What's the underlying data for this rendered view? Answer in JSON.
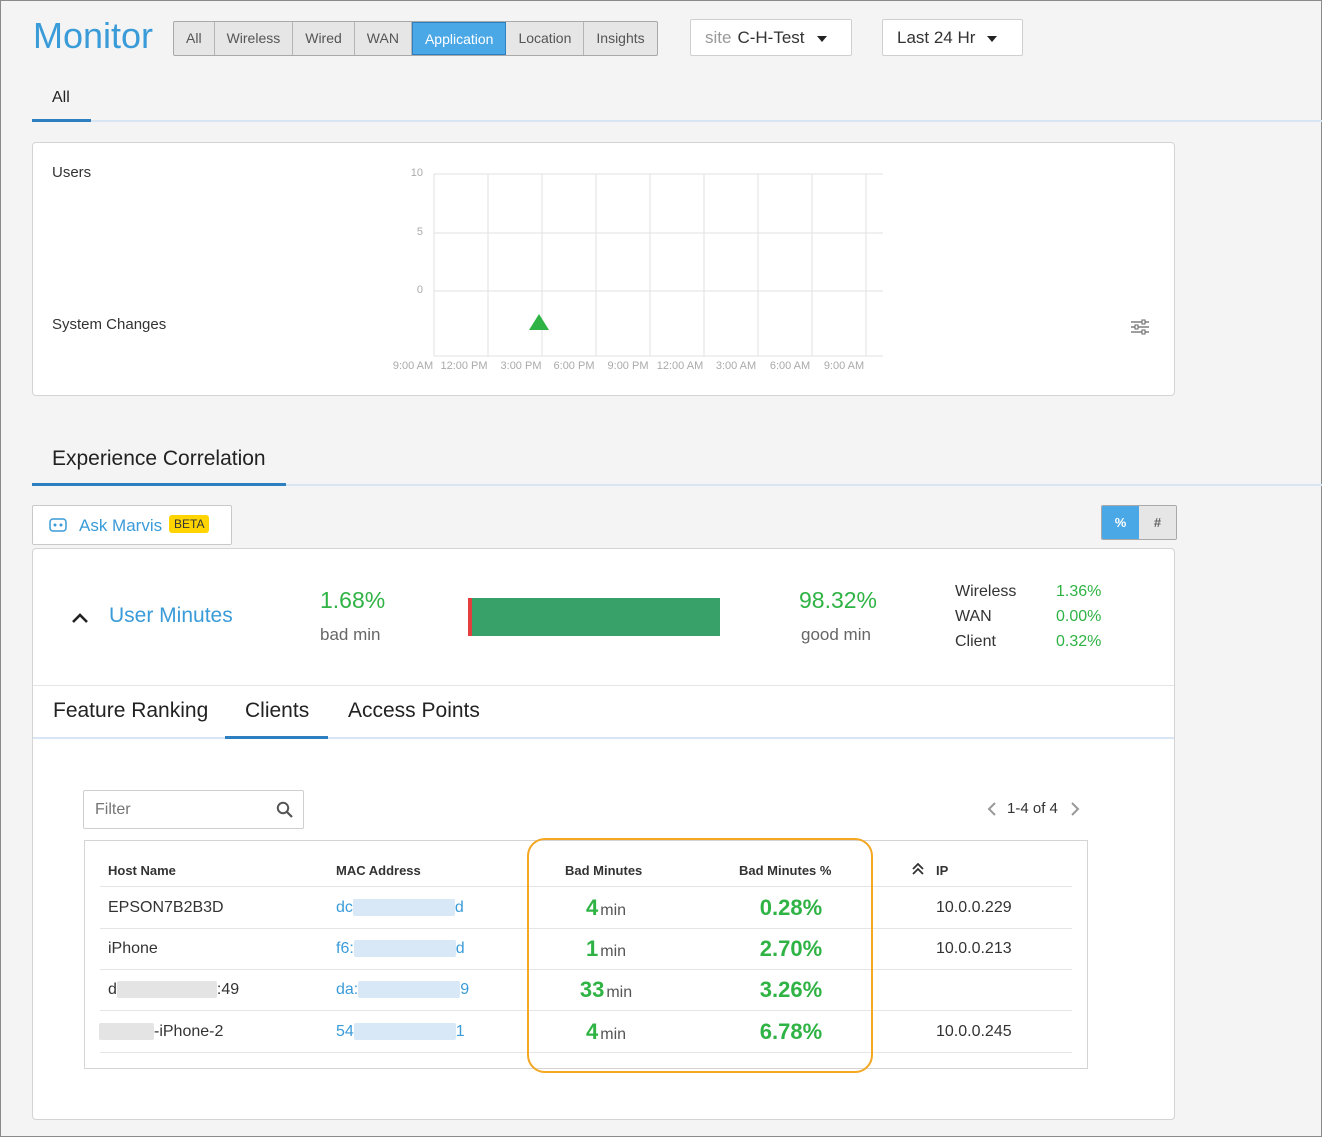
{
  "header": {
    "title": "Monitor",
    "tabs": [
      "All",
      "Wireless",
      "Wired",
      "WAN",
      "Application",
      "Location",
      "Insights"
    ],
    "active_tab": "Application",
    "site_label": "site",
    "site_value": "C-H-Test",
    "time_range": "Last 24 Hr"
  },
  "subtab": {
    "label": "All"
  },
  "chart_panel": {
    "users_label": "Users",
    "system_changes_label": "System Changes",
    "chart_data": {
      "type": "line",
      "title": "",
      "ylabel": "",
      "xlabel": "",
      "ylim": [
        0,
        10
      ],
      "y_ticks": [
        "10",
        "5",
        "0"
      ],
      "x_ticks": [
        "9:00 AM",
        "12:00 PM",
        "3:00 PM",
        "6:00 PM",
        "9:00 PM",
        "12:00 AM",
        "3:00 AM",
        "6:00 AM",
        "9:00 AM"
      ],
      "series": [],
      "markers": [
        {
          "x": "3:00 PM",
          "type": "system-change",
          "color": "#2fb344"
        }
      ],
      "grid": true
    },
    "settings_icon": "sliders-icon"
  },
  "experience": {
    "title": "Experience Correlation",
    "ask_marvis": "Ask Marvis",
    "beta": "BETA",
    "toggle": [
      "%",
      "#"
    ],
    "toggle_active": "%"
  },
  "summary": {
    "metric": "User Minutes",
    "bad_pct": "1.68%",
    "bad_label": "bad min",
    "good_pct": "98.32%",
    "good_label": "good min",
    "bad_fraction": 0.0168,
    "breakdown": [
      {
        "name": "Wireless",
        "value": "1.36%"
      },
      {
        "name": "WAN",
        "value": "0.00%"
      },
      {
        "name": "Client",
        "value": "0.32%"
      }
    ],
    "colors": {
      "good": "#38a169",
      "bad": "#e53e3e"
    }
  },
  "detail_tabs": [
    "Feature Ranking",
    "Clients",
    "Access Points"
  ],
  "detail_active": "Clients",
  "filter": {
    "placeholder": "Filter"
  },
  "pagination": {
    "text": "1-4 of 4"
  },
  "table": {
    "headers": [
      "Host Name",
      "MAC Address",
      "Bad Minutes",
      "Bad Minutes %",
      "IP"
    ],
    "rows": [
      {
        "host_pre": "EPSON7B2B3D",
        "host_post": "",
        "mac_pre": "dc",
        "mac_post": "d",
        "bad_min": "4",
        "unit": "min",
        "bad_pct": "0.28%",
        "ip": "10.0.0.229"
      },
      {
        "host_pre": "iPhone",
        "host_post": "",
        "mac_pre": "f6:",
        "mac_post": "d",
        "bad_min": "1",
        "unit": "min",
        "bad_pct": "2.70%",
        "ip": "10.0.0.213"
      },
      {
        "host_pre": "d",
        "host_post": ":49",
        "mac_pre": "da:",
        "mac_post": "9",
        "bad_min": "33",
        "unit": "min",
        "bad_pct": "3.26%",
        "ip": ""
      },
      {
        "host_pre": "",
        "host_post": "-iPhone-2",
        "mac_pre": "54",
        "mac_post": "1",
        "bad_min": "4",
        "unit": "min",
        "bad_pct": "6.78%",
        "ip": "10.0.0.245"
      }
    ]
  },
  "highlight_color": "#f5a623"
}
